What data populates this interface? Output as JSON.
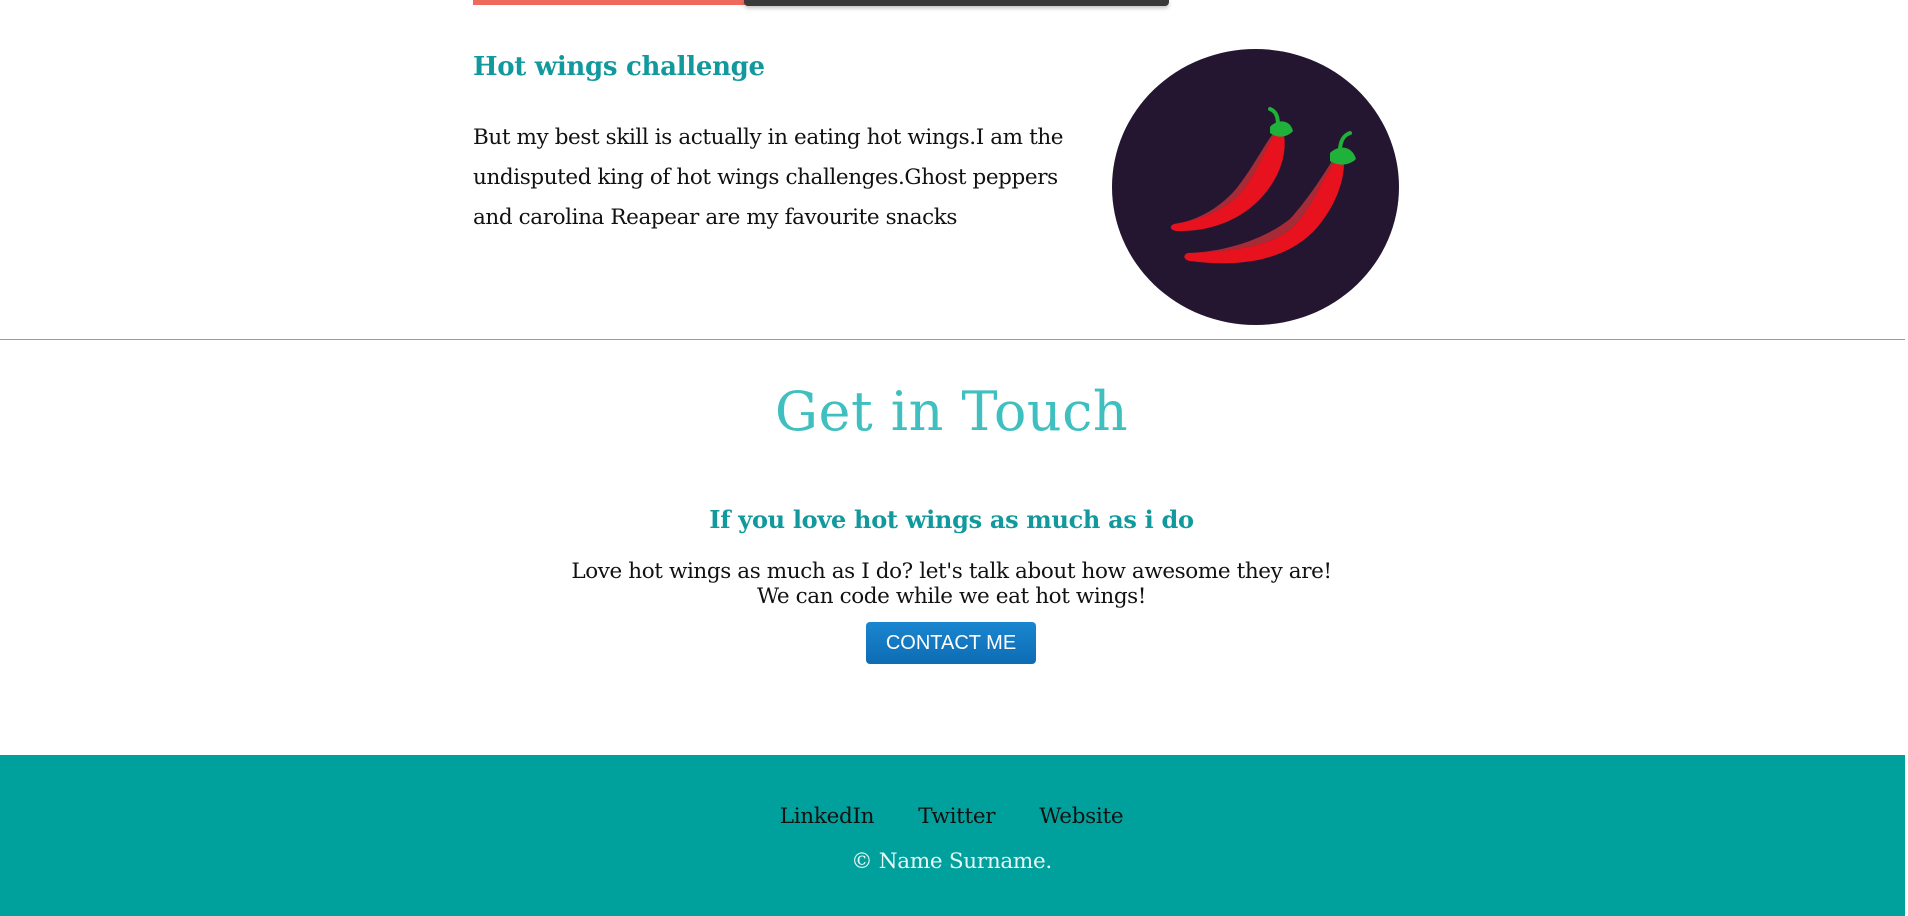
{
  "skill": {
    "title": "Hot wings challenge",
    "text": "But my best skill is actually in eating hot wings.I am the undisputed king of hot wings challenges.Ghost peppers and carolina Reapear are my favourite snacks",
    "image_icon": "chili-peppers-icon"
  },
  "contact": {
    "title": "Get in Touch",
    "subtitle": "If you love hot wings as much as i do",
    "text": "Love hot wings as much as I do? let's talk about how awesome they are! We can code while we eat hot wings!",
    "button_label": "CONTACT ME"
  },
  "footer": {
    "links": [
      "LinkedIn",
      "Twitter",
      "Website"
    ],
    "copyright": "© Name Surname."
  },
  "colors": {
    "accent_teal": "#11999e",
    "title_teal": "#40bfc1",
    "footer_bg": "#00a19d",
    "button_blue": "#1a86d0",
    "circle_bg": "#241631",
    "top_strip_coral": "#ee6a5d"
  }
}
